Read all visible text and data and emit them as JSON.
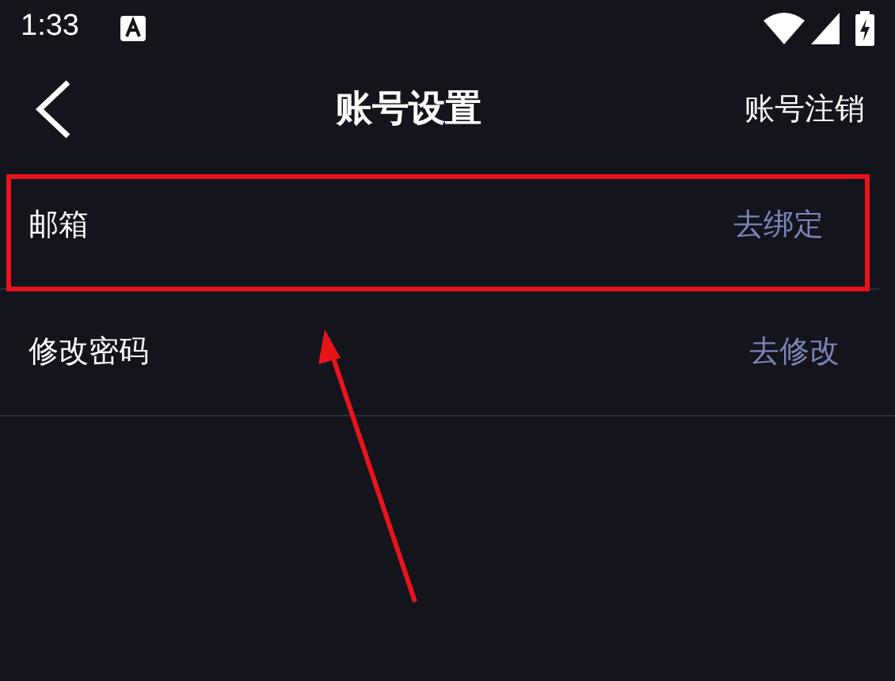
{
  "status_bar": {
    "time": "1:33"
  },
  "header": {
    "title": "账号设置",
    "action": "账号注销"
  },
  "rows": [
    {
      "label": "邮箱",
      "action": "去绑定",
      "highlighted": true
    },
    {
      "label": "修改密码",
      "action": "去修改",
      "highlighted": false
    }
  ]
}
